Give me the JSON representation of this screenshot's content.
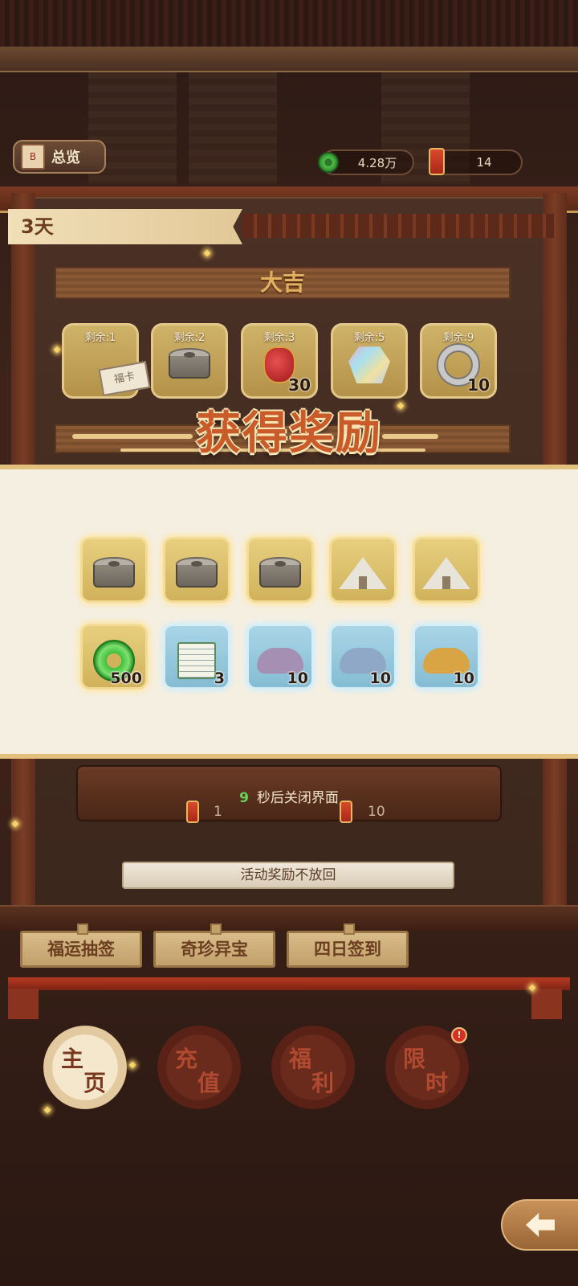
{
  "hud": {
    "overview_label": "总览",
    "overview_icon_text": "B",
    "currency": "4.28万",
    "tickets": "14"
  },
  "day_tab": "3天",
  "tier": {
    "title": "大吉",
    "prizes": [
      {
        "remain": "剩余:1",
        "qty": "",
        "icon": "ticket-icon",
        "ticket_text": "福卡"
      },
      {
        "remain": "剩余:2",
        "qty": "",
        "icon": "stone-mill-icon"
      },
      {
        "remain": "剩余:3",
        "qty": "30",
        "icon": "red-pouch-icon"
      },
      {
        "remain": "剩余:5",
        "qty": "",
        "icon": "gem-icon"
      },
      {
        "remain": "剩余:9",
        "qty": "10",
        "icon": "ring-icon"
      }
    ]
  },
  "reward_popup": {
    "title": "获得奖励",
    "rewards_row1": [
      {
        "icon": "stone-mill-icon",
        "qty": ""
      },
      {
        "icon": "stone-mill-icon",
        "qty": ""
      },
      {
        "icon": "stone-mill-icon",
        "qty": ""
      },
      {
        "icon": "tent-icon",
        "qty": ""
      },
      {
        "icon": "tent-icon",
        "qty": ""
      }
    ],
    "rewards_row2": [
      {
        "icon": "jade-coin-icon",
        "qty": "500",
        "color": "#3fbf3f"
      },
      {
        "icon": "book-scroll-icon",
        "qty": "3"
      },
      {
        "icon": "purple-powder-icon",
        "qty": "10",
        "color": "#a58fb3"
      },
      {
        "icon": "blue-powder-icon",
        "qty": "10",
        "color": "#8fa8c8"
      },
      {
        "icon": "gold-powder-icon",
        "qty": "10",
        "color": "#d9a444"
      }
    ],
    "countdown": "9",
    "close_text": "秒后关闭界面"
  },
  "altar": {
    "left_count": "1",
    "right_count": "10"
  },
  "notice": "活动奖励不放回",
  "tabs": [
    "福运抽签",
    "奇珍异宝",
    "四日签到"
  ],
  "nav": [
    {
      "c1": "主",
      "c2": "页",
      "active": true
    },
    {
      "c1": "充",
      "c2": "值",
      "active": false
    },
    {
      "c1": "福",
      "c2": "利",
      "active": false
    },
    {
      "c1": "限",
      "c2": "时",
      "active": false
    }
  ],
  "badge": "!",
  "colors": {
    "gold_slot": "#d1b25b",
    "blue_slot": "#84bcd3",
    "title_orange": "#c95a2a",
    "countdown_green": "#6bd25a"
  }
}
